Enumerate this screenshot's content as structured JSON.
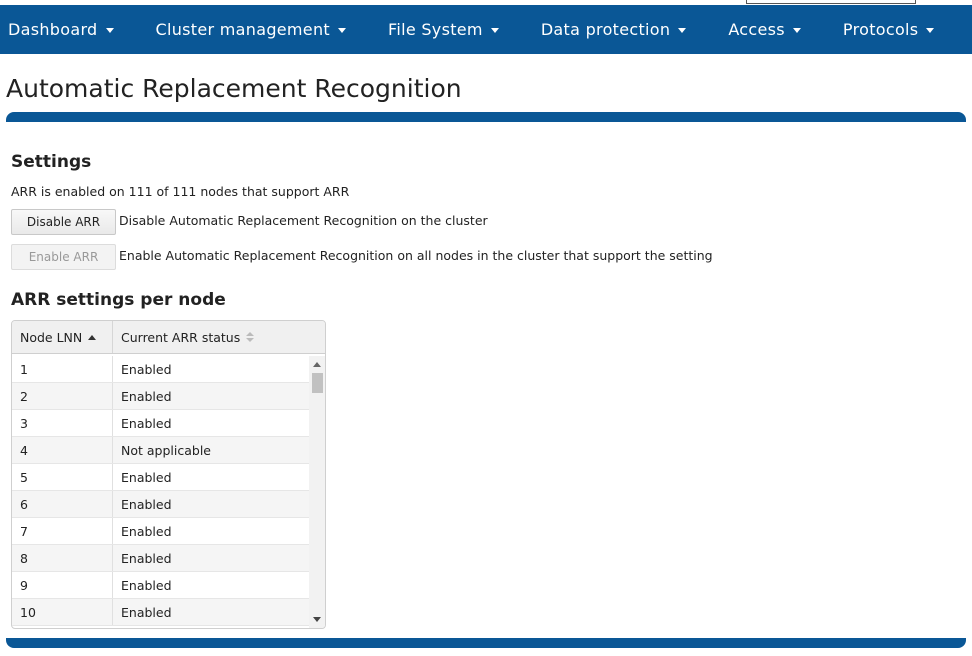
{
  "nav": {
    "items": [
      {
        "label": "Dashboard"
      },
      {
        "label": "Cluster management"
      },
      {
        "label": "File System"
      },
      {
        "label": "Data protection"
      },
      {
        "label": "Access"
      },
      {
        "label": "Protocols"
      }
    ]
  },
  "page": {
    "title": "Automatic Replacement Recognition"
  },
  "settings": {
    "heading": "Settings",
    "status_text": "ARR is enabled on 111 of 111 nodes that support ARR",
    "disable_button": "Disable ARR",
    "disable_desc": "Disable Automatic Replacement Recognition on the cluster",
    "enable_button": "Enable ARR",
    "enable_desc": "Enable Automatic Replacement Recognition on all nodes in the cluster that support the setting"
  },
  "per_node": {
    "heading": "ARR settings per node",
    "columns": [
      "Node LNN",
      "Current ARR status"
    ],
    "rows": [
      [
        "1",
        "Enabled"
      ],
      [
        "2",
        "Enabled"
      ],
      [
        "3",
        "Enabled"
      ],
      [
        "4",
        "Not applicable"
      ],
      [
        "5",
        "Enabled"
      ],
      [
        "6",
        "Enabled"
      ],
      [
        "7",
        "Enabled"
      ],
      [
        "8",
        "Enabled"
      ],
      [
        "9",
        "Enabled"
      ],
      [
        "10",
        "Enabled"
      ]
    ]
  },
  "colors": {
    "brand": "#0a5796"
  }
}
